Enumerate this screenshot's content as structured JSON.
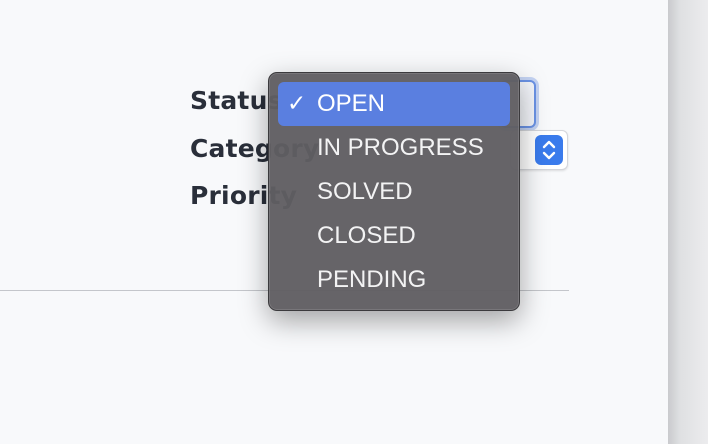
{
  "form": {
    "status_label": "Status",
    "category_label": "Category",
    "priority_label": "Priority"
  },
  "status_dropdown": {
    "selected": "OPEN",
    "check_glyph": "✓",
    "options": [
      "OPEN",
      "IN PROGRESS",
      "SOLVED",
      "CLOSED",
      "PENDING"
    ]
  },
  "icons": {
    "stepper": "up-down-chevron-icon",
    "check": "checkmark-icon"
  },
  "colors": {
    "accent": "#3a7bec",
    "selection_highlight": "#5a7fe0",
    "menu_background": "#605e62",
    "panel_background": "#f8f9fb",
    "label_text": "#2a2f3a"
  }
}
